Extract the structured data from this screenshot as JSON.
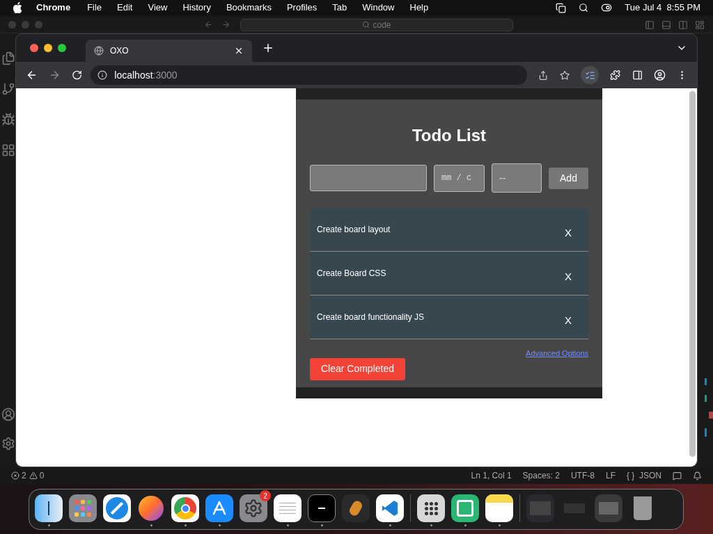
{
  "menu_bar": {
    "app": "Chrome",
    "items": [
      "File",
      "Edit",
      "View",
      "History",
      "Bookmarks",
      "Profiles",
      "Tab",
      "Window",
      "Help"
    ],
    "clock": "Tue Jul 4  8:55 PM"
  },
  "editor": {
    "search": "code",
    "errors": "2",
    "warnings": "0",
    "status_items": [
      "Ln 1, Col 1",
      "Spaces: 2",
      "UTF-8",
      "LF",
      "{ }  JSON"
    ]
  },
  "browser": {
    "tabs": [
      {
        "title": "OXO",
        "selected": true
      }
    ],
    "url_host": "localhost",
    "url_port": ":3000"
  },
  "todo_app": {
    "title": "Todo List",
    "date_placeholder": "mm / c",
    "time_placeholder": "--",
    "add_button": "Add",
    "todos": [
      {
        "text": "Create board layout",
        "remove": "X"
      },
      {
        "text": "Create Board CSS",
        "remove": "X"
      },
      {
        "text": "Create board functionality JS",
        "remove": "X"
      }
    ],
    "advanced_link": "Advanced Options",
    "clear_button": "Clear Completed"
  },
  "dock": {
    "settings_badge": "2"
  }
}
